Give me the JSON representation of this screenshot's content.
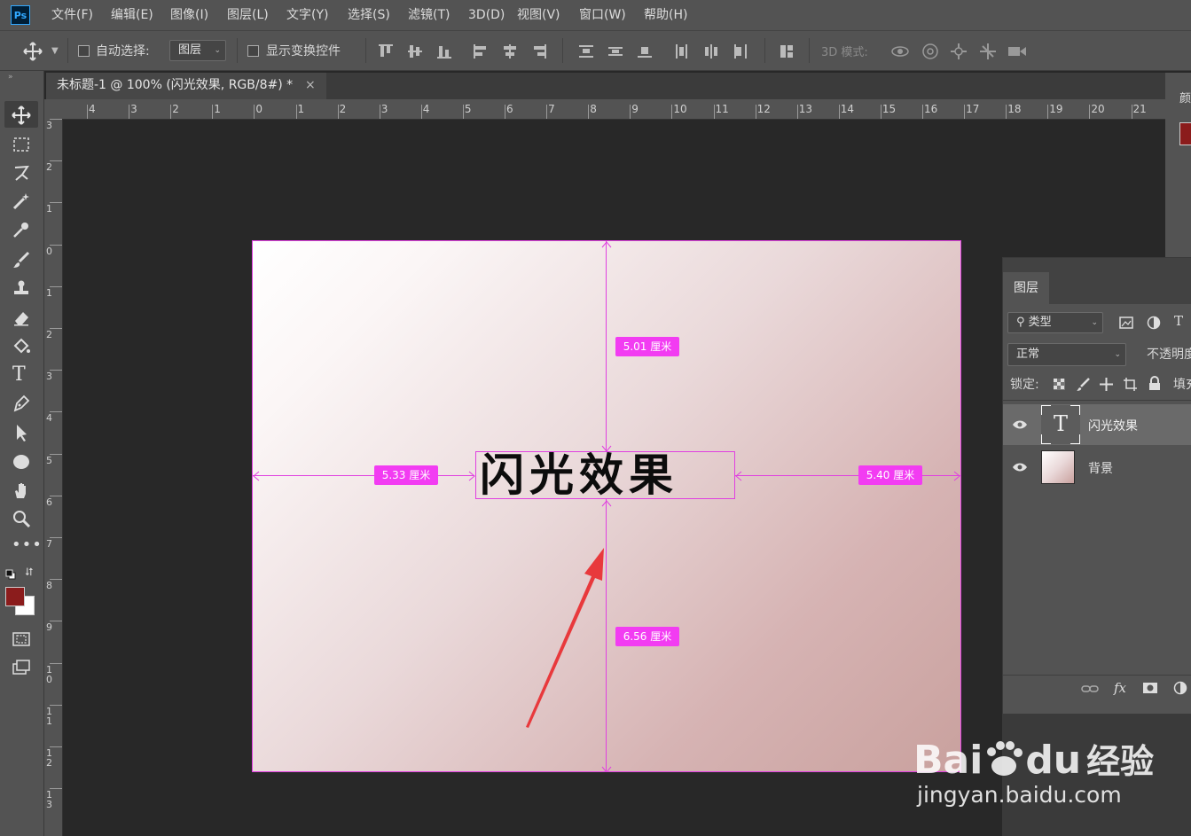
{
  "menu": [
    "文件(F)",
    "编辑(E)",
    "图像(I)",
    "图层(L)",
    "文字(Y)",
    "选择(S)",
    "滤镜(T)",
    "3D(D)",
    "视图(V)",
    "窗口(W)",
    "帮助(H)"
  ],
  "app_logo": "Ps",
  "options": {
    "auto_select_label": "自动选择:",
    "auto_select_value": "图层",
    "show_transform_label": "显示变换控件",
    "mode_3d_label": "3D 模式:"
  },
  "document": {
    "tab_title": "未标题-1 @ 100% (闪光效果, RGB/8#) *",
    "close_glyph": "×"
  },
  "rulers": {
    "top": [
      "4",
      "3",
      "2",
      "1",
      "0",
      "1",
      "2",
      "3",
      "4",
      "5",
      "6",
      "7",
      "8",
      "9",
      "10",
      "11",
      "12",
      "13",
      "14",
      "15",
      "16",
      "17",
      "18",
      "19",
      "20",
      "21"
    ],
    "left": [
      "3",
      "2",
      "1",
      "0",
      "1",
      "2",
      "3",
      "4",
      "5",
      "6",
      "7",
      "8",
      "9",
      "10",
      "11",
      "12",
      "13"
    ]
  },
  "canvas": {
    "text": "闪光效果",
    "measure_top": "5.01 厘米",
    "measure_left": "5.33 厘米",
    "measure_right": "5.40 厘米",
    "measure_bottom": "6.56 厘米",
    "guide_color": "#e040e0",
    "arrow_color": "#e8393c"
  },
  "colors": {
    "foreground": "#8b1c1c",
    "background": "#ffffff"
  },
  "layers_panel": {
    "tab": "图层",
    "filter_label": "类型",
    "blend_mode": "正常",
    "opacity_label": "不透明度",
    "lock_label": "锁定:",
    "fill_label": "填充",
    "layers": [
      {
        "name": "闪光效果",
        "type": "text",
        "thumb_glyph": "T"
      },
      {
        "name": "背景",
        "type": "image"
      }
    ],
    "footer_fx": "fx"
  },
  "right_panel_header": "颜",
  "watermark": {
    "line1_a": "Bai",
    "line1_b": "du",
    "line1_c": "经验",
    "line2": "jingyan.baidu.com"
  }
}
